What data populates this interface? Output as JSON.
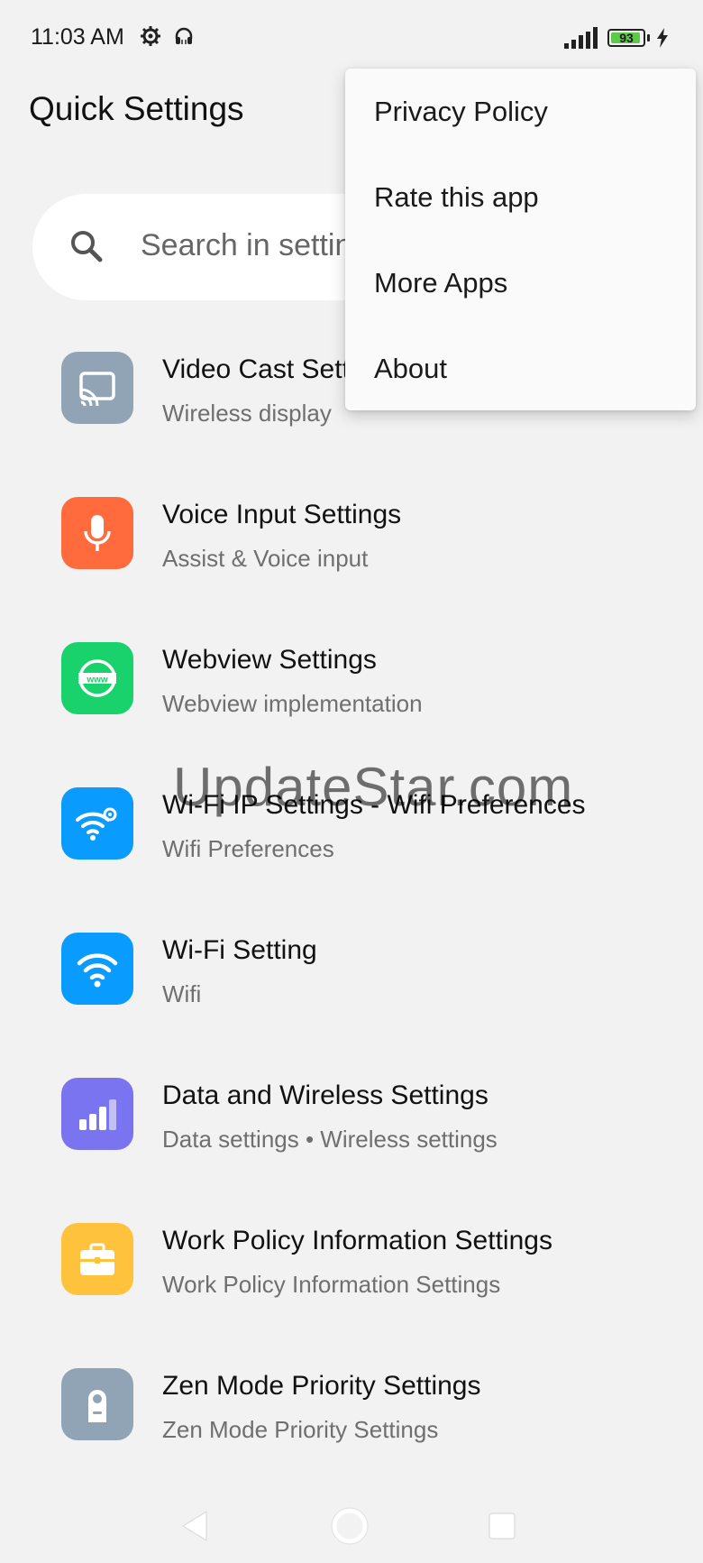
{
  "status_bar": {
    "time": "11:03 AM",
    "battery_level": "93",
    "battery_fraction": 0.93,
    "icons": [
      "gear-icon",
      "headset-icon",
      "signal-icon",
      "battery-icon",
      "charging-bolt-icon"
    ]
  },
  "header": {
    "title": "Quick Settings"
  },
  "search": {
    "placeholder": "Search in settings",
    "icon": "search-icon"
  },
  "settings_list": [
    {
      "title": "Video Cast Settings",
      "subtitle": "Wireless display",
      "icon": "cast-icon",
      "color": "#90a4b5"
    },
    {
      "title": "Voice Input Settings",
      "subtitle": "Assist & Voice input",
      "icon": "microphone-icon",
      "color": "#ff6b3d"
    },
    {
      "title": "Webview Settings",
      "subtitle": "Webview implementation",
      "icon": "globe-www-icon",
      "color": "#19d26b"
    },
    {
      "title": "Wi-Fi IP Settings - Wifi Preferences",
      "subtitle": "Wifi Preferences",
      "icon": "wifi-gear-icon",
      "color": "#0a9bff"
    },
    {
      "title": "Wi-Fi Setting",
      "subtitle": "Wifi",
      "icon": "wifi-icon",
      "color": "#0a9bff"
    },
    {
      "title": "Data and Wireless Settings",
      "subtitle": "Data settings • Wireless settings",
      "icon": "signal-bars-icon",
      "color": "#7b74f0"
    },
    {
      "title": "Work Policy Information Settings",
      "subtitle": "Work Policy Information Settings",
      "icon": "briefcase-icon",
      "color": "#ffc23d"
    },
    {
      "title": "Zen Mode Priority Settings",
      "subtitle": "Zen Mode Priority Settings",
      "icon": "door-hanger-icon",
      "color": "#90a4b5"
    }
  ],
  "overflow_menu": {
    "items": [
      {
        "label": "Privacy Policy"
      },
      {
        "label": "Rate this app"
      },
      {
        "label": "More Apps"
      },
      {
        "label": "About"
      }
    ]
  },
  "watermark": "UpdateStar.com",
  "nav_bar": {
    "icons": [
      "back-icon",
      "home-icon",
      "recents-icon"
    ]
  }
}
